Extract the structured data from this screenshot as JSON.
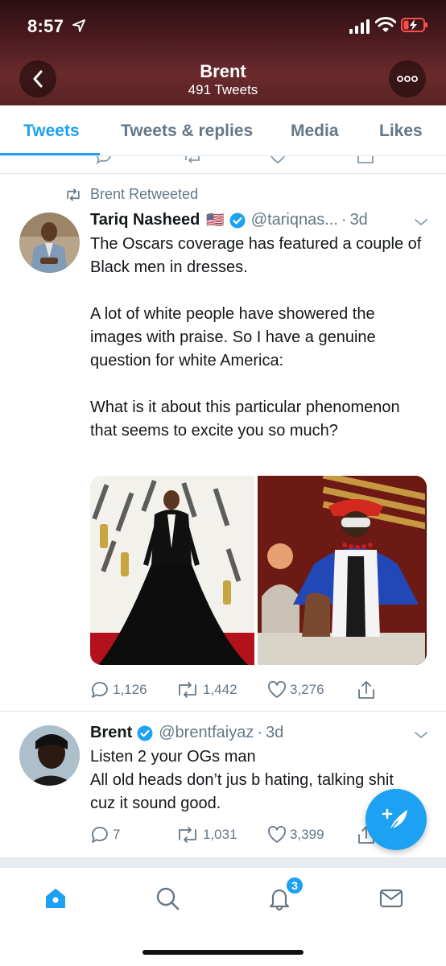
{
  "status_bar": {
    "time": "8:57"
  },
  "header": {
    "name": "Brent",
    "tweet_count": "491 Tweets"
  },
  "tabs": [
    {
      "label": "Tweets",
      "active": true
    },
    {
      "label": "Tweets & replies",
      "active": false
    },
    {
      "label": "Media",
      "active": false
    },
    {
      "label": "Likes",
      "active": false
    }
  ],
  "tweets": [
    {
      "retweeted_by": "Brent Retweeted",
      "name": "Tariq Nasheed",
      "flag": "🇺🇸",
      "handle": "@tariqnas...",
      "age": "3d",
      "text": "The Oscars coverage has featured a couple of Black men in dresses.\n\nA lot of white people have showered the images with praise. So I have a genuine question for white America:\n\nWhat is it about this particular phenomenon that seems to excite you so much?",
      "replies": "1,126",
      "retweets": "1,442",
      "likes": "3,276"
    },
    {
      "name": "Brent",
      "handle": "@brentfaiyaz",
      "age": "3d",
      "text": "Listen 2 your OGs man\nAll old heads don’t jus b hating, talking shit cuz it sound good.",
      "replies": "7",
      "retweets": "1,031",
      "likes": "3,399"
    }
  ],
  "bottom_nav": {
    "notifications_badge": "3"
  },
  "colors": {
    "accent": "#1da1f2",
    "secondary_text": "#657786",
    "verified": "#1da1f2"
  }
}
